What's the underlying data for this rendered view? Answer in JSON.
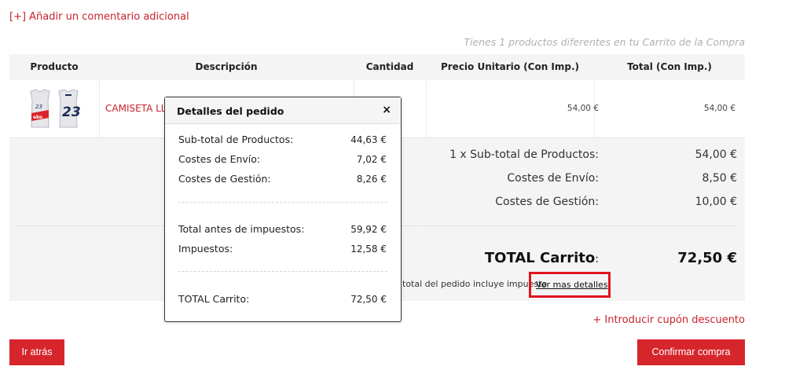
{
  "comment_link": "[+] Añadir un comentario adicional",
  "cart_info": "Tienes 1 productos diferentes en tu Carrito de la Compra",
  "table": {
    "headers": {
      "product": "Producto",
      "description": "Descripción",
      "quantity": "Cantidad",
      "unit_price": "Precio Unitario (Con Imp.)",
      "total": "Total (Con Imp.)"
    }
  },
  "item": {
    "name": "CAMISETA LLU",
    "unit_price": "54,00 €",
    "total": "54,00 €"
  },
  "summary": {
    "subtotal_label": "1 x Sub-total de Productos:",
    "subtotal_value": "54,00 €",
    "shipping_label": "Costes de Envío:",
    "shipping_value": "8,50 €",
    "handling_label": "Costes de Gestión:",
    "handling_value": "10,00 €",
    "total_label": "TOTAL Carrito",
    "total_colon": ":",
    "total_value": "72,50 €",
    "tax_note": "total del pedido incluye impuesto",
    "details_link": "Ver mas detalles"
  },
  "coupon_link": "+ Introducir cupón descuento",
  "buttons": {
    "back": "Ir atrás",
    "confirm": "Confirmar compra"
  },
  "popup": {
    "title": "Detalles del pedido",
    "close": "×",
    "rows": [
      {
        "label": "Sub-total de Productos:",
        "value": "44,63 €"
      },
      {
        "label": "Costes de Envío:",
        "value": "7,02 €"
      },
      {
        "label": "Costes de Gestión:",
        "value": "8,26 €"
      },
      {
        "label": "Total antes de impuestos:",
        "value": "59,92 €"
      },
      {
        "label": "Impuestos:",
        "value": "12,58 €"
      },
      {
        "label": "TOTAL Carrito:",
        "value": "72,50 €"
      }
    ]
  },
  "colors": {
    "accent": "#d6262c",
    "link_red": "#c8232c",
    "highlight": "#e0141f"
  }
}
